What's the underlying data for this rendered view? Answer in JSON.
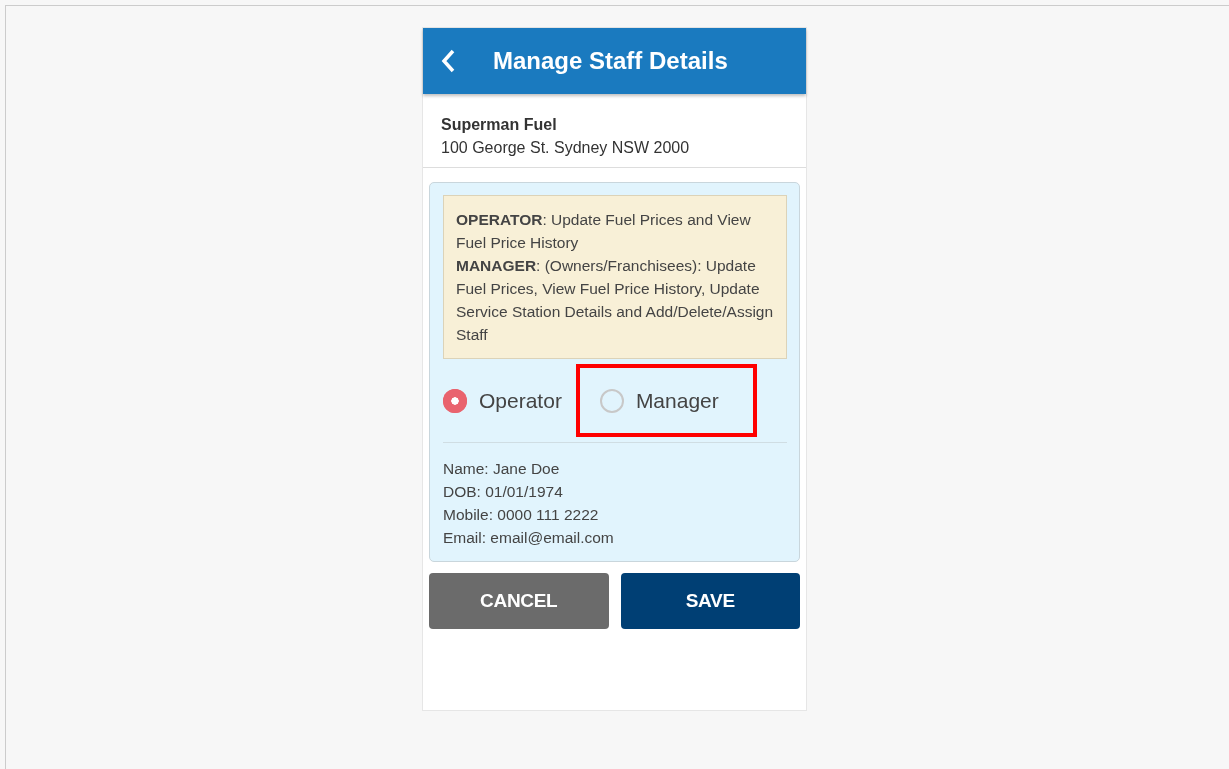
{
  "header": {
    "title": "Manage Staff Details"
  },
  "station": {
    "name": "Superman Fuel",
    "address": "100 George St. Sydney NSW 2000"
  },
  "role_info": [
    "**OPERATOR**: Update Fuel Prices and View Fuel Price History",
    "**MANAGER**: (Owners/Franchisees): Update Fuel Prices, View Fuel Price History, Update Service Station Details and Add/Delete/Assign Staff"
  ],
  "roles": [
    {
      "label": "Operator",
      "selected": true,
      "highlighted": false
    },
    {
      "label": "Manager",
      "selected": false,
      "highlighted": true
    }
  ],
  "details": [
    "Name: Jane Doe",
    "DOB: 01/01/1974",
    "Mobile: 0000 111 2222",
    "Email: email@email.com"
  ],
  "buttons": [
    {
      "label": "CANCEL",
      "kind": "secondary"
    },
    {
      "label": "SAVE",
      "kind": "primary"
    }
  ]
}
